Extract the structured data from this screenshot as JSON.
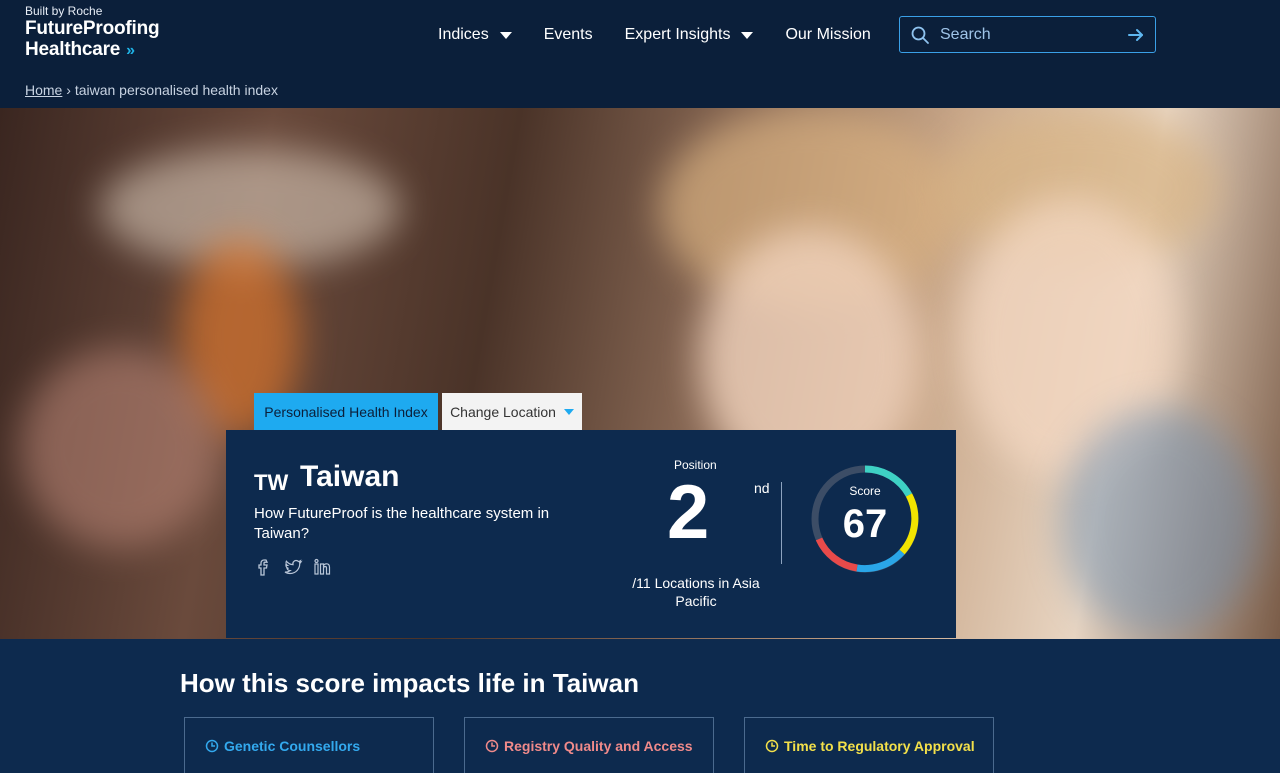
{
  "brand": {
    "built_by": "Built by Roche",
    "line1": "FutureProofing",
    "line2": "Healthcare",
    "chevron": "»"
  },
  "nav": {
    "items": [
      {
        "label": "Indices",
        "has_dropdown": true
      },
      {
        "label": "Events",
        "has_dropdown": false
      },
      {
        "label": "Expert Insights",
        "has_dropdown": true
      },
      {
        "label": "Our Mission",
        "has_dropdown": false
      }
    ]
  },
  "search": {
    "placeholder": "Search",
    "icon": "search-icon",
    "submit_icon": "arrow-right-icon"
  },
  "breadcrumb": {
    "home": "Home",
    "separator": "›",
    "current": "taiwan personalised health index"
  },
  "tabs": {
    "active": "Personalised Health Index",
    "location": "Change Location"
  },
  "panel": {
    "code": "TW",
    "country": "Taiwan",
    "question": "How FutureProof is the healthcare system in Taiwan?",
    "socials": [
      "facebook-icon",
      "twitter-icon",
      "linkedin-icon"
    ],
    "position_label": "Position",
    "position": "2",
    "position_ordinal": "nd",
    "position_of": "/11 Locations in Asia Pacific",
    "score_label": "Score",
    "score": "67"
  },
  "impact": {
    "title": "How this score impacts life in Taiwan",
    "cards": [
      {
        "label": "Genetic Counsellors",
        "color": "#33a9ee"
      },
      {
        "label": "Registry Quality and Access",
        "color": "#f08a8a"
      },
      {
        "label": "Time to Regulatory Approval",
        "color": "#f3e04a"
      }
    ]
  },
  "colors": {
    "background": "#0b1f3a",
    "panel": "#0d2a4e",
    "accent": "#1eaaf0",
    "gauge_teal": "#3ed1c4",
    "gauge_yellow": "#f2e400",
    "gauge_blue": "#2aa6e8",
    "gauge_red": "#e84a4a",
    "gauge_track": "#3c4d66"
  }
}
